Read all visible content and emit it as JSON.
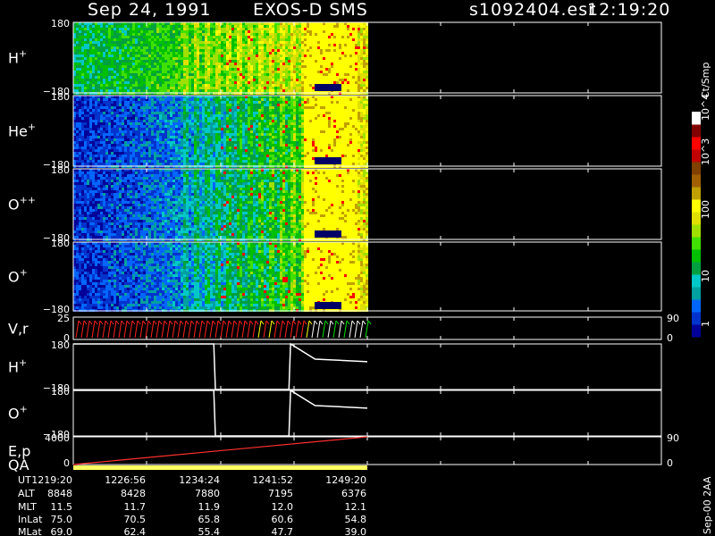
{
  "header": {
    "date": "Sep 24, 1991",
    "instrument": "EXOS-D SMS",
    "file": "s1092404.esr",
    "time": "12:19:20"
  },
  "colorbar": {
    "unit": "Ct/Smp",
    "tick_labels": [
      "1",
      "10",
      "100",
      "10^3",
      "10^4"
    ],
    "colors": [
      "#000099",
      "#0033cc",
      "#0066ff",
      "#00a0a0",
      "#00c8c8",
      "#00a040",
      "#00c000",
      "#40e000",
      "#a0e000",
      "#e0e000",
      "#ffff00",
      "#c0a000",
      "#a06000",
      "#804000",
      "#c00000",
      "#ff0000",
      "#800000",
      "#ffffff"
    ]
  },
  "panels": [
    {
      "label": "H",
      "sup": "+",
      "top": "180",
      "bottom": "−180"
    },
    {
      "label": "He",
      "sup": "+",
      "top": "180",
      "bottom": "−180"
    },
    {
      "label": "O",
      "sup": "++",
      "top": "180",
      "bottom": "−180"
    },
    {
      "label": "O",
      "sup": "+",
      "top": "180",
      "bottom": "−180"
    },
    {
      "label": "V,r",
      "sup": "",
      "top": "25",
      "bottom": "0",
      "right_top": "90",
      "right_bottom": "0"
    },
    {
      "label": "H",
      "sup": "+",
      "top": "180",
      "bottom": "−180"
    },
    {
      "label": "O",
      "sup": "+",
      "top": "180",
      "bottom": "−180"
    },
    {
      "label": "E,p",
      "sup": "",
      "top": "4000",
      "bottom": "0",
      "right_top": "90",
      "right_bottom": "0",
      "label2": "QA"
    }
  ],
  "axis_table": {
    "row_labels": [
      "UT",
      "ALT",
      "MLT",
      "InLat",
      "MLat"
    ],
    "columns": [
      [
        "1219:20",
        "8848",
        "11.5",
        "75.0",
        "69.0"
      ],
      [
        "1226:56",
        "8428",
        "11.7",
        "70.5",
        "62.4"
      ],
      [
        "1234:24",
        "7880",
        "11.9",
        "65.8",
        "55.4"
      ],
      [
        "1241:52",
        "7195",
        "12.0",
        "60.6",
        "47.7"
      ],
      [
        "1249:20",
        "6376",
        "12.1",
        "54.8",
        "39.0"
      ]
    ]
  },
  "side_note": "Sep-00 2AA",
  "chart_data": {
    "type": "heatmap",
    "x_ut": [
      "1219:20",
      "1226:56",
      "1234:24",
      "1241:52",
      "1249:20"
    ],
    "data_end_ut": "1249:20",
    "pitch_angle_range": [
      -180,
      180
    ],
    "H_plus_pitch_line": {
      "x_ut": [
        "1219:20",
        "1233:40",
        "1233:50",
        "1241:20",
        "1241:30",
        "1244:00",
        "1249:20"
      ],
      "y_deg": [
        180,
        180,
        -180,
        -180,
        180,
        60,
        40
      ]
    },
    "O_plus_pitch_line": {
      "x_ut": [
        "1219:20",
        "1233:40",
        "1233:50",
        "1241:20",
        "1241:30",
        "1244:00",
        "1249:20"
      ],
      "y_deg": [
        180,
        180,
        -180,
        -180,
        180,
        60,
        40
      ]
    },
    "E_line": {
      "x_ut": [
        "1219:20",
        "1249:20"
      ],
      "y": [
        0,
        4000
      ]
    }
  }
}
